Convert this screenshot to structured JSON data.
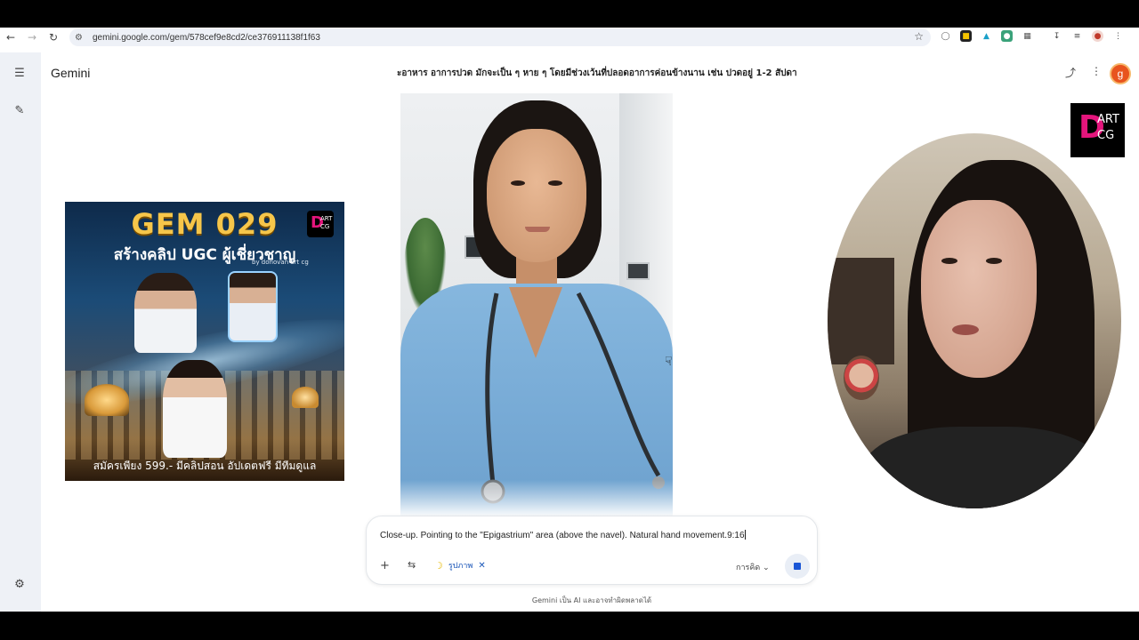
{
  "browser": {
    "url": "gemini.google.com/gem/578cef9e8cd2/ce376911138f1f63"
  },
  "app": {
    "title": "Gemini",
    "chat_title": "ะอาหาร อาการปวด มักจะเป็น ๆ หาย ๆ โดยมีช่วงเว้นที่ปลอดอาการค่อนข้างนาน เช่น ปวดอยู่ 1-2 สัปดา",
    "avatar_letter": "g"
  },
  "logo": {
    "d": "D",
    "art": "ART",
    "cg": "CG"
  },
  "promo": {
    "title": "GEM 029",
    "subtitle": "สร้างคลิป UGC ผู้เชี่ยวชาญ",
    "byline": "by donovan art cg",
    "footer": "สมัครเพียง 599.- มีคลิปสอน อัปเดตฟรี มีทีมดูแล"
  },
  "prompt": {
    "text": "Close-up. Pointing to the \"Epigastrium\" area (above the navel). Natural hand movement.9:16",
    "chip_label": "รูปภาพ",
    "mode_label": "การคิด"
  },
  "footer": {
    "disclaimer": "Gemini เป็น AI และอาจทำผิดพลาดได้"
  },
  "colors": {
    "accent": "#1a56d6",
    "avatar_bg": "#e8541e",
    "sidebar_bg": "#eef1f6",
    "logo_pink": "#e4157c"
  },
  "icons": {
    "back": "arrow-left-icon",
    "forward": "arrow-right-icon",
    "reload": "reload-icon",
    "menu": "hamburger-icon",
    "new_chat": "edit-icon",
    "settings": "gear-icon",
    "share": "share-icon",
    "more": "more-vert-icon",
    "add": "plus-icon",
    "tools": "tune-icon",
    "stop": "stop-icon"
  }
}
